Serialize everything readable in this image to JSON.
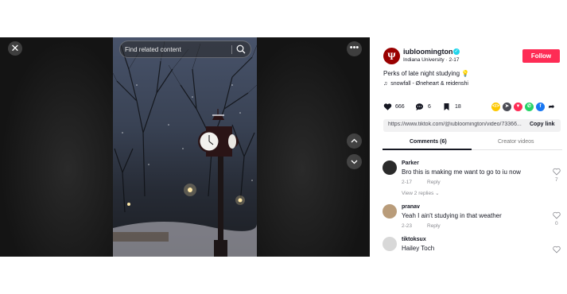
{
  "viewer": {
    "search_placeholder": "Find related content",
    "close_icon": "close-icon",
    "more_icon": "more-horizontal-icon",
    "up_icon": "chevron-up-icon",
    "down_icon": "chevron-down-icon"
  },
  "post": {
    "username": "iubloomington",
    "display_name": "Indiana University",
    "date": "2-17",
    "caption": "Perks of late night studying 💡",
    "music": "snowfall - Øneheart & reidenshi",
    "follow_label": "Follow",
    "avatar_letter": "Ψ",
    "brand_color": "#990000",
    "follow_color": "#fe2c55"
  },
  "stats": {
    "likes": "666",
    "comments": "6",
    "saves": "18"
  },
  "share": {
    "icons": [
      "embed-icon",
      "send-icon",
      "repost-icon",
      "whatsapp-icon",
      "facebook-icon",
      "share-arrow-icon"
    ]
  },
  "link": {
    "url": "https://www.tiktok.com/@iubloomington/video/73366...",
    "copy_label": "Copy link"
  },
  "tabs": {
    "comments": "Comments (6)",
    "creator": "Creator videos"
  },
  "comments": [
    {
      "user": "Parker",
      "text": "Bro this is making me want to go to iu now",
      "date": "2-17",
      "reply": "Reply",
      "likes": "7",
      "view_replies": "View 2 replies ⌄"
    },
    {
      "user": "pranav",
      "text": "Yeah I ain't studying in that weather",
      "date": "2-23",
      "reply": "Reply",
      "likes": "0"
    },
    {
      "user": "tiktoksux",
      "text": "Hailey Toch"
    }
  ]
}
